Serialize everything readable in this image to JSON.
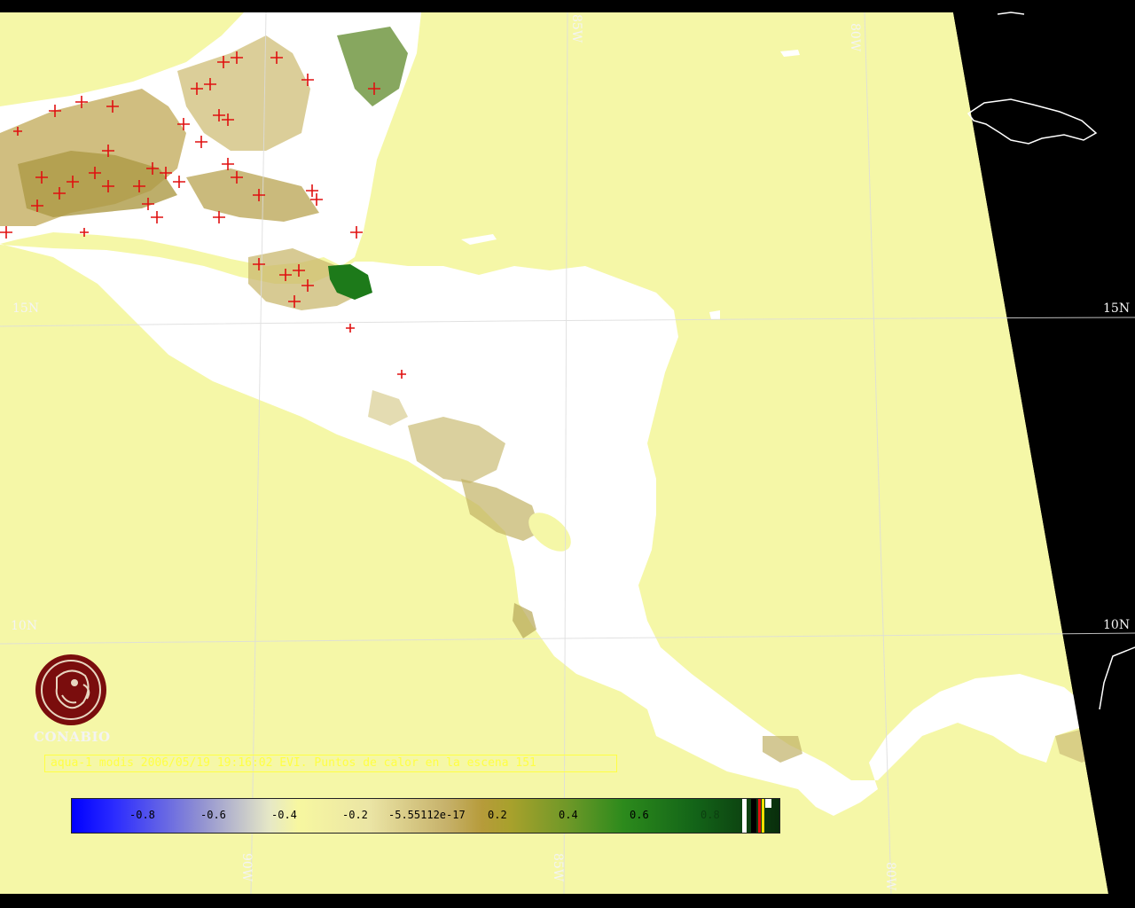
{
  "grid_labels": {
    "lat_15_left": "15N",
    "lat_15_right": "15N",
    "lat_10_left": "10N",
    "lat_10_right": "10N",
    "lon_85_top": "85W",
    "lon_80_top": "80W",
    "lon_90_bottom": "90W",
    "lon_85_bottom": "85W",
    "lon_80_bottom": "80W"
  },
  "logo": {
    "text": "CONABIO",
    "icon": "conabio-macaw-logo-icon"
  },
  "caption": "aqua-1 modis 2006/05/19 19:16:02 EVI. Puntos de calor en la escena 151",
  "colorbar": {
    "ticks": [
      "-0.8",
      "-0.6",
      "-0.4",
      "-0.2",
      "-5.55112e-17",
      "0.2",
      "0.4",
      "0.6",
      "0.8"
    ]
  },
  "colors": {
    "ocean": "#f5f7a7",
    "land_cloud": "#ffffff",
    "vegetation": "#3e8a1e",
    "hotspot": "#e01010",
    "no_data": "#000000",
    "caption_text": "#ffff44"
  }
}
